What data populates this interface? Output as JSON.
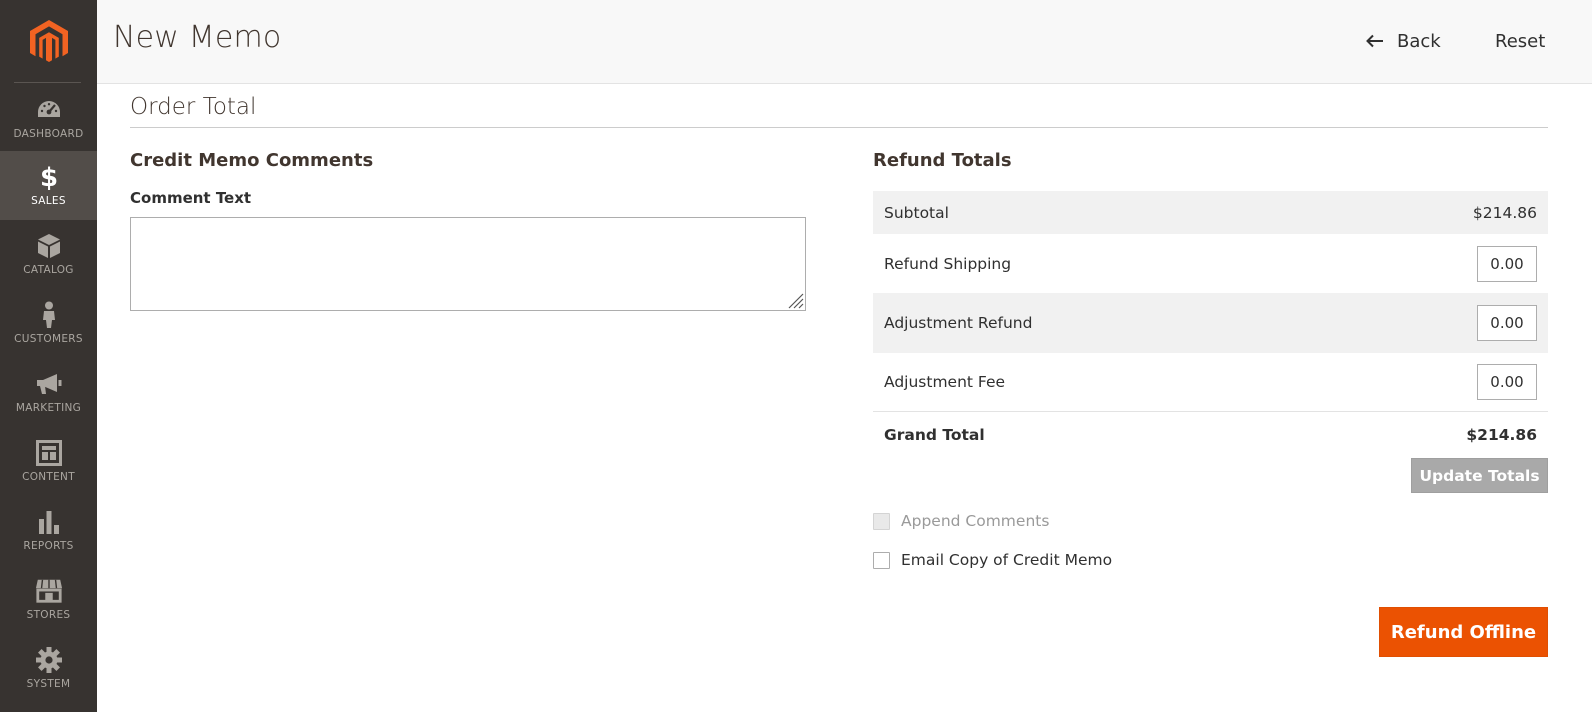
{
  "colors": {
    "sidebar_bg": "#373330",
    "sidebar_active_bg": "#524d49",
    "brand_orange": "#eb5202",
    "logo_orange": "#f26322"
  },
  "sidebar": {
    "logo_icon": "magento-logo-icon",
    "items": [
      {
        "label": "DASHBOARD",
        "icon": "speedometer-icon",
        "active": false
      },
      {
        "label": "SALES",
        "icon": "dollar-icon",
        "active": true
      },
      {
        "label": "CATALOG",
        "icon": "cube-icon",
        "active": false
      },
      {
        "label": "CUSTOMERS",
        "icon": "person-icon",
        "active": false
      },
      {
        "label": "MARKETING",
        "icon": "megaphone-icon",
        "active": false
      },
      {
        "label": "CONTENT",
        "icon": "layout-icon",
        "active": false
      },
      {
        "label": "REPORTS",
        "icon": "bar-chart-icon",
        "active": false
      },
      {
        "label": "STORES",
        "icon": "storefront-icon",
        "active": false
      },
      {
        "label": "SYSTEM",
        "icon": "gear-icon",
        "active": false
      }
    ]
  },
  "header": {
    "title": "New Memo",
    "back_label": "Back",
    "reset_label": "Reset"
  },
  "main": {
    "section_title": "Order Total",
    "comments": {
      "title": "Credit Memo Comments",
      "label": "Comment Text",
      "value": ""
    },
    "refund_totals": {
      "title": "Refund Totals",
      "subtotal_label": "Subtotal",
      "subtotal_value": "$214.86",
      "refund_shipping_label": "Refund Shipping",
      "refund_shipping_value": "0.00",
      "adjustment_refund_label": "Adjustment Refund",
      "adjustment_refund_value": "0.00",
      "adjustment_fee_label": "Adjustment Fee",
      "adjustment_fee_value": "0.00",
      "grand_total_label": "Grand Total",
      "grand_total_value": "$214.86",
      "update_button_label": "Update Totals"
    },
    "options": {
      "append_comments_label": "Append Comments",
      "append_comments_checked": false,
      "append_comments_disabled": true,
      "email_copy_label": "Email Copy of Credit Memo",
      "email_copy_checked": false
    },
    "refund_button_label": "Refund Offline"
  }
}
